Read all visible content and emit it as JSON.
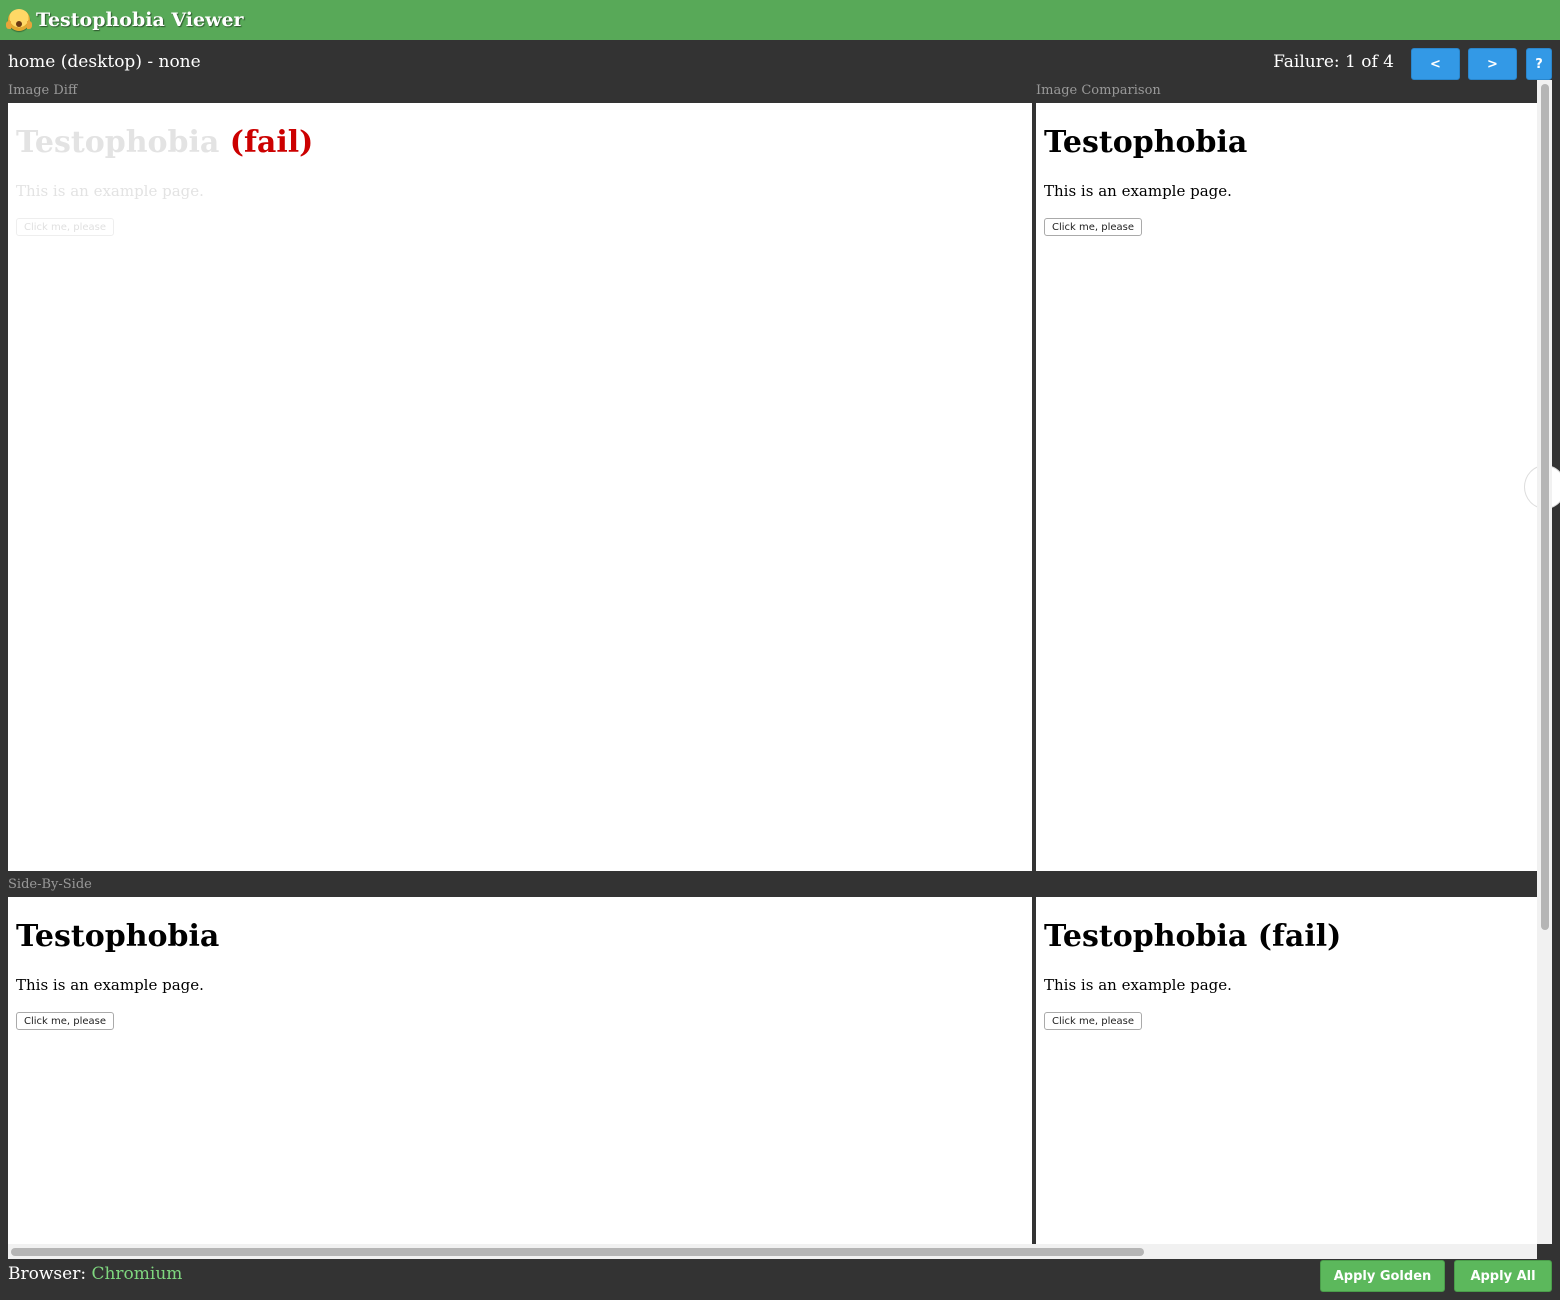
{
  "app": {
    "title": "Testophobia Viewer",
    "logo_icon": "face-screaming-in-fear-icon"
  },
  "test": {
    "name": "home (desktop) - none",
    "failure_text": "Failure: 1 of 4"
  },
  "nav": {
    "prev_label": "<",
    "next_label": ">",
    "help_label": "?"
  },
  "panels": {
    "diff_label": "Image Diff",
    "comparison_label": "Image Comparison",
    "side_by_side_label": "Side-By-Side"
  },
  "sample_page": {
    "heading": "Testophobia",
    "heading_fail_suffix": "(fail)",
    "heading_fail_full": "Testophobia (fail)",
    "paragraph": "This is an example page.",
    "button": "Click me, please"
  },
  "footer": {
    "browser_prefix": "Browser:",
    "browser_name": "Chromium",
    "apply_golden": "Apply Golden",
    "apply_all": "Apply All"
  },
  "colors": {
    "header_green": "#58a958",
    "background": "#333333",
    "nav_blue": "#3399e6",
    "action_green": "#5cb85c",
    "diff_red": "#cc0000",
    "browser_name_green": "#7fd77f"
  }
}
